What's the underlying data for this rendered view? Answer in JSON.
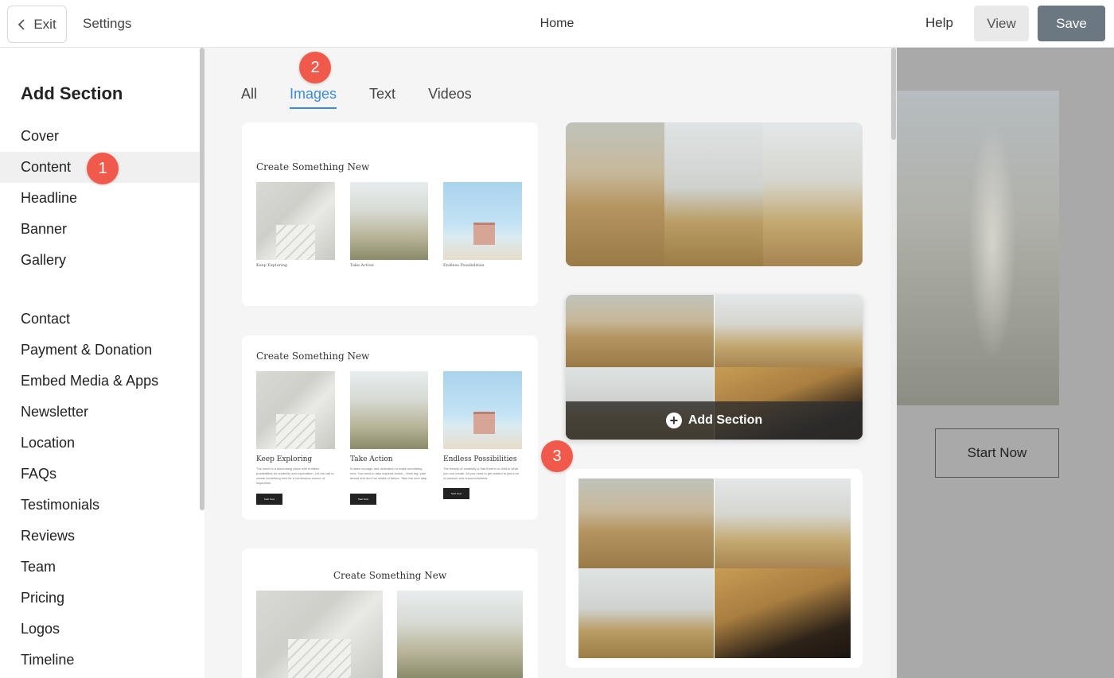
{
  "topbar": {
    "exit_label": "Exit",
    "settings_label": "Settings",
    "page_name": "Home",
    "help_label": "Help",
    "view_label": "View",
    "save_label": "Save"
  },
  "sidebar": {
    "title": "Add Section",
    "items": [
      {
        "label": "Cover"
      },
      {
        "label": "Content"
      },
      {
        "label": "Headline"
      },
      {
        "label": "Banner"
      },
      {
        "label": "Gallery"
      },
      {
        "label": "Contact"
      },
      {
        "label": "Payment & Donation"
      },
      {
        "label": "Embed Media & Apps"
      },
      {
        "label": "Newsletter"
      },
      {
        "label": "Location"
      },
      {
        "label": "FAQs"
      },
      {
        "label": "Testimonials"
      },
      {
        "label": "Reviews"
      },
      {
        "label": "Team"
      },
      {
        "label": "Pricing"
      },
      {
        "label": "Logos"
      },
      {
        "label": "Timeline"
      }
    ]
  },
  "tabs": [
    {
      "label": "All"
    },
    {
      "label": "Images"
    },
    {
      "label": "Text"
    },
    {
      "label": "Videos"
    }
  ],
  "cards": {
    "card1": {
      "title": "Create Something New",
      "captions": [
        "Keep Exploring",
        "Take Action",
        "Endless Possibilities"
      ]
    },
    "card2": {
      "title": "Create Something New",
      "captions": [
        "Keep Exploring",
        "Take Action",
        "Endless Possibilities"
      ],
      "texts": [
        "The world is a fascinating place with endless possibilities for creativity and exploration. Let the call to create something new be a continuous source of inspiration.",
        "It takes courage and dedication to make something new. You need to take inspired action – think big, plan ahead and don't be afraid of failure. Take the next step.",
        "The beauty of creativity is that there's no limit to what you can create. All you need to get started is just a bit of passion and resourcefulness."
      ],
      "button_label": "Start Now"
    },
    "card3": {
      "title": "Create Something New"
    },
    "grid_card": {
      "add_section_label": "Add Section"
    }
  },
  "badges": [
    "1",
    "2",
    "3"
  ],
  "preview": {
    "button_label": "Start Now"
  }
}
